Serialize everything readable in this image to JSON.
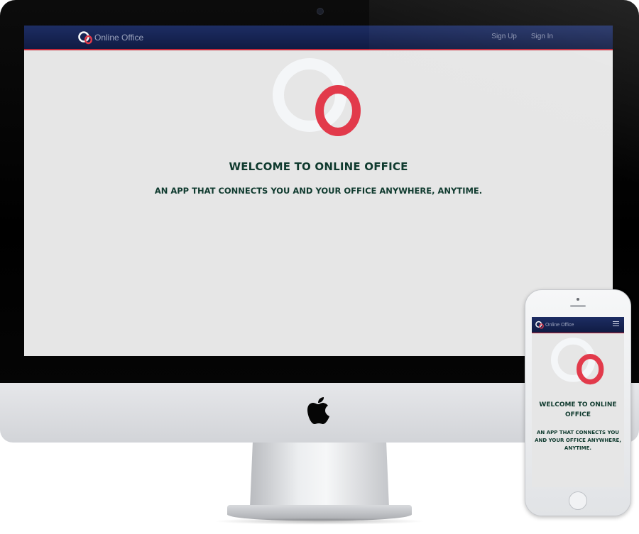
{
  "desktop": {
    "navbar": {
      "brand_name": "Online Office",
      "links": [
        {
          "label": "Sign Up"
        },
        {
          "label": "Sign In"
        }
      ]
    },
    "hero": {
      "logo_icon": "online-office-logo-icon",
      "heading": "WELCOME TO ONLINE OFFICE",
      "tagline": "AN APP THAT CONNECTS YOU AND YOUR OFFICE ANYWHERE, ANYTIME."
    }
  },
  "mobile": {
    "navbar": {
      "brand_name": "Online Office",
      "menu_icon": "hamburger-menu-icon"
    },
    "hero": {
      "heading": "WELCOME TO ONLINE OFFICE",
      "tagline": "AN APP THAT CONNECTS YOU AND YOUR OFFICE ANYWHERE, ANYTIME."
    }
  },
  "colors": {
    "navbar": "#142253",
    "accent_red": "#e23a4b",
    "logo_white": "#f4f6f8",
    "heading_green": "#0f3a2e",
    "page_background": "#e6e6e6"
  }
}
